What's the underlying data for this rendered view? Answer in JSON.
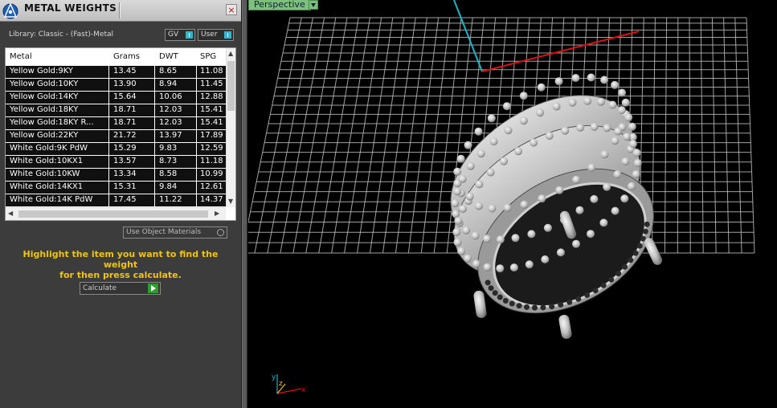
{
  "panel": {
    "title": "METAL WEIGHTS",
    "close_glyph": "×",
    "library_label": "Library: Classic - (Fast)-Metal",
    "toggles": [
      {
        "label": "GV"
      },
      {
        "label": "User"
      }
    ],
    "columns": [
      "Metal",
      "Grams",
      "DWT",
      "SPG"
    ],
    "rows": [
      [
        "Yellow Gold:9KY",
        "13.45",
        "8.65",
        "11.08"
      ],
      [
        "Yellow Gold:10KY",
        "13.90",
        "8.94",
        "11.45"
      ],
      [
        "Yellow Gold:14KY",
        "15.64",
        "10.06",
        "12.88"
      ],
      [
        "Yellow Gold:18KY",
        "18.71",
        "12.03",
        "15.41"
      ],
      [
        "Yellow Gold:18KY R...",
        "18.71",
        "12.03",
        "15.41"
      ],
      [
        "Yellow Gold:22KY",
        "21.72",
        "13.97",
        "17.89"
      ],
      [
        "White Gold:9K PdW",
        "15.29",
        "9.83",
        "12.59"
      ],
      [
        "White Gold:10KX1",
        "13.57",
        "8.73",
        "11.18"
      ],
      [
        "White Gold:10KW",
        "13.34",
        "8.58",
        "10.99"
      ],
      [
        "White Gold:14KX1",
        "15.31",
        "9.84",
        "12.61"
      ],
      [
        "White Gold:14K PdW",
        "17.45",
        "11.22",
        "14.37"
      ]
    ],
    "use_object_materials": "Use Object Materials",
    "hint_line1": "Highlight the item you want to find the weight",
    "hint_line2": "for then press calculate.",
    "calculate_label": "Calculate"
  },
  "viewport": {
    "view_name": "Perspective",
    "axis_labels": {
      "y": "y",
      "z": "z",
      "x": "x"
    },
    "colors": {
      "x_axis": "#e01010",
      "y_axis": "#17b6c8",
      "grid": "#bdbdbd",
      "hint": "#f2c40f"
    }
  }
}
